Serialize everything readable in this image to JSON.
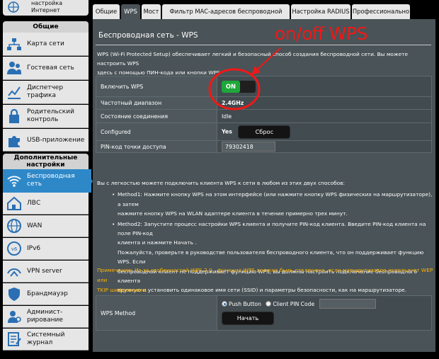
{
  "sidebar": {
    "top_item": {
      "line1": "настройка",
      "line2": "Интернет",
      "icon": "globe-icon"
    },
    "general_header": "Общие",
    "general_items": [
      {
        "label": "Карта сети",
        "icon": "network-map-icon"
      },
      {
        "label": "Гостевая сеть",
        "icon": "guest-network-icon"
      },
      {
        "label1": "Диспетчер",
        "label2": "трафика",
        "icon": "traffic-manager-icon"
      },
      {
        "label1": "Родительский",
        "label2": "контроль",
        "icon": "lock-icon"
      },
      {
        "label": "USB-приложение",
        "icon": "puzzle-icon"
      }
    ],
    "advanced_header": {
      "line1": "Дополнительные",
      "line2": "настройки"
    },
    "advanced_items": [
      {
        "label1": "Беспроводная",
        "label2": "сеть",
        "icon": "wifi-icon",
        "active": true
      },
      {
        "label": "ЛВС",
        "icon": "home-icon"
      },
      {
        "label": "WAN",
        "icon": "globe-icon"
      },
      {
        "label": "IPv6",
        "icon": "ipv6-icon"
      },
      {
        "label": "VPN server",
        "icon": "vpn-icon"
      },
      {
        "label": "Брандмауэр",
        "icon": "shield-icon"
      },
      {
        "label1": "Админист-",
        "label2": "рирование",
        "icon": "admin-icon"
      },
      {
        "label1": "Системный",
        "label2": "журнал",
        "icon": "log-icon"
      }
    ]
  },
  "tabs": [
    "Общие",
    "WPS",
    "Мост",
    "Фильтр MAC-адресов беспроводной сети",
    "Настройка RADIUS",
    "Профессионально"
  ],
  "active_tab": "WPS",
  "page_title": "Беспроводная сеть - WPS",
  "description_line1": "WPS (Wi-Fi Protected Setup) обеспечивает легкий и безопасный способ создания беспроводной сети. Вы можете настроить WPS",
  "description_line2": "здесь с помощью ПИН-кода или кнопки WPS",
  "form": {
    "enable_wps_label": "Включить WPS",
    "toggle_state": "ON",
    "band_label": "Частотный диапазон",
    "band_value": "2.4GHz",
    "status_label": "Состояние соединения",
    "status_value": "Idle",
    "configured_label": "Configured",
    "configured_value": "Yes",
    "reset_button": "Сброс",
    "pin_label": "PIN-код точки доступа",
    "pin_value": "79302418"
  },
  "info": {
    "intro": "Вы с легкостью можете подключить клиента WPS к сети в любом из этих двух способов:",
    "method1_line1": "Method1: Нажмите кнопку WPS на этом интерфейсе (или нажмите кнопку WPS физических на маршрутизаторе), а затем",
    "method1_line2": "нажмите кнопку WPS на WLAN адаптере клиента в течение примерно трех минут.",
    "method2_line1": "Method2: Запустите процесс настройки WPS клиента и получите PIN-код клиента. Введите PIN-код клиента на поле PIN-код",
    "method2_line2": "клиента и нажмите Начать .",
    "method2_line3": "Пожалуйста, проверьте в руководстве пользователя беспроводного клиента, что он поддерживает функцию WPS. Если",
    "method2_line4": "беспроводной клиент не поддерживает функцию WPS, вы должны настроить подключение беспроводного клиента",
    "method2_line5": "вручную и установить одинаковое имя сети (SSID) и параметры безопасности, как на маршрутизаторе."
  },
  "note_line1": "Примечание: Из за особенностей WPS 2.0 , функция WPS должна быть отключена, если маршрутизатор использует WEP или",
  "note_line2": "TKIP шифрование.",
  "method": {
    "label": "WPS Method",
    "option_push": "Push Button",
    "option_pin": "Client PIN Code",
    "selected": "Push Button",
    "start_button": "Начать"
  },
  "annotation": "on/off WPS",
  "colors": {
    "accent": "#2e88c8",
    "panel": "#4a5357",
    "toggle_on": "#1ea83a",
    "status_idle": "#ff9c00",
    "note": "#ffb400",
    "annotation": "#f01818"
  }
}
